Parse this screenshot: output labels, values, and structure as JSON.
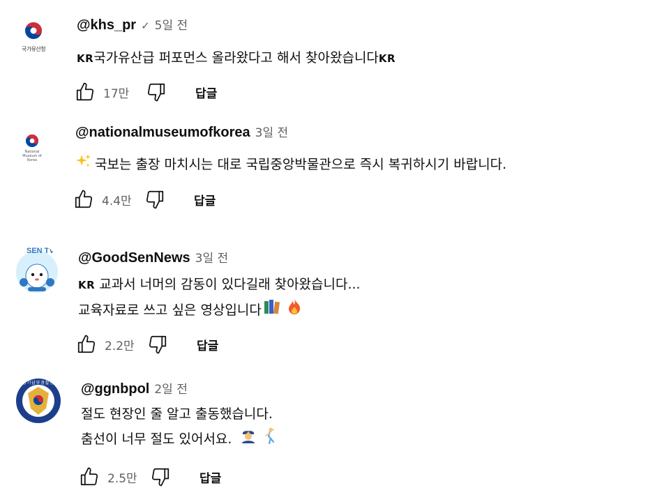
{
  "comments": [
    {
      "avatar_label": "국가유산청",
      "author": "@khs_pr",
      "verified": true,
      "time": "5일 전",
      "prefix": "KR",
      "text": "국가유산급 퍼포먼스 올라왔다고 해서 찾아왔습니다",
      "suffix": "KR",
      "likes": "17만",
      "reply": "답글"
    },
    {
      "avatar_label": "National Museum of Korea",
      "author": "@nationalmuseumofkorea",
      "time": "3일 전",
      "emoji": "sparkles",
      "text": "국보는 출장 마치시는 대로 국립중앙박물관으로 즉시 복귀하시기 바랍니다.",
      "likes": "4.4만",
      "reply": "답글"
    },
    {
      "avatar_label": "SEN TV",
      "author": "@GoodSenNews",
      "time": "3일 전",
      "prefix": "KR",
      "line1": "교과서 너머의 감동이 있다길래 찾아왔습니다...",
      "line2": "교육자료로 쓰고 싶은 영상입니다",
      "emojis": [
        "books",
        "fire"
      ],
      "likes": "2.2만",
      "reply": "답글"
    },
    {
      "avatar_label": "경기남부경찰청",
      "author": "@ggnbpol",
      "time": "2일 전",
      "line1": "절도 현장인 줄 알고 출동했습니다.",
      "line2": "춤선이 너무 절도 있어서요.",
      "emojis": [
        "police-officer",
        "dancing-man"
      ],
      "likes": "2.5만",
      "reply": "답글"
    }
  ],
  "colors": {
    "text": "#0f0f0f",
    "secondary": "#606060",
    "taeguk_red": "#cd2e3a",
    "taeguk_blue": "#0047a0",
    "police_gold": "#e3b23c",
    "police_navy": "#1c3f8c"
  }
}
